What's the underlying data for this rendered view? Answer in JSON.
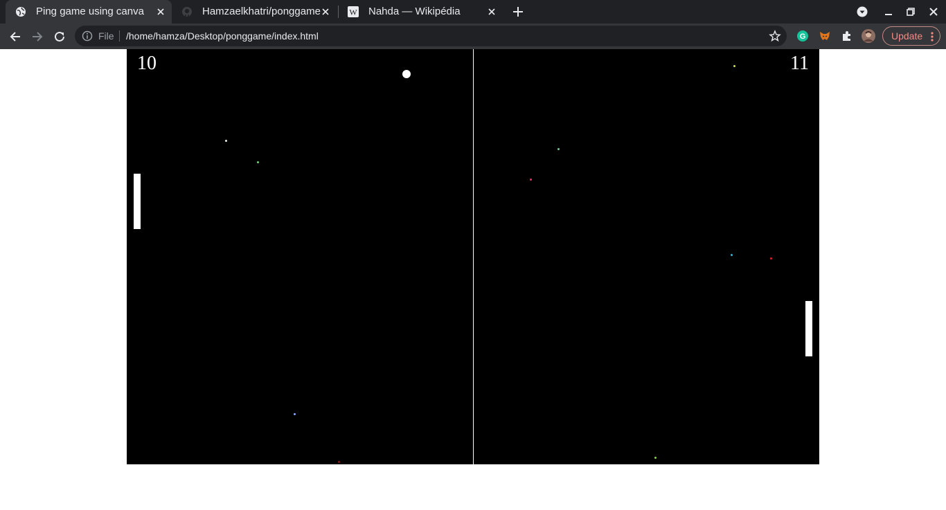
{
  "browser": {
    "tabs": [
      {
        "title": "Ping game using canva",
        "active": true,
        "icon": "globe-icon"
      },
      {
        "title": "Hamzaelkhatri/ponggame",
        "active": false,
        "icon": "github-icon"
      },
      {
        "title": "Nahda — Wikipédia",
        "active": false,
        "icon": "wikipedia-icon"
      }
    ],
    "url_scheme": "File",
    "url": "/home/hamza/Desktop/ponggame/index.html",
    "update_label": "Update",
    "colors": {
      "tabstrip": "#202124",
      "toolbar": "#35363a",
      "update": "#f28b82"
    }
  },
  "game": {
    "score_left": "10",
    "score_right": "11",
    "particle_colors": [
      "#e6f0e6",
      "#72d66b",
      "#8fa7ff",
      "#8b1a1a",
      "#6fcf97",
      "#e8336b",
      "#38b6d6",
      "#e81c2c",
      "#c6e84a",
      "#7cd64a"
    ]
  }
}
